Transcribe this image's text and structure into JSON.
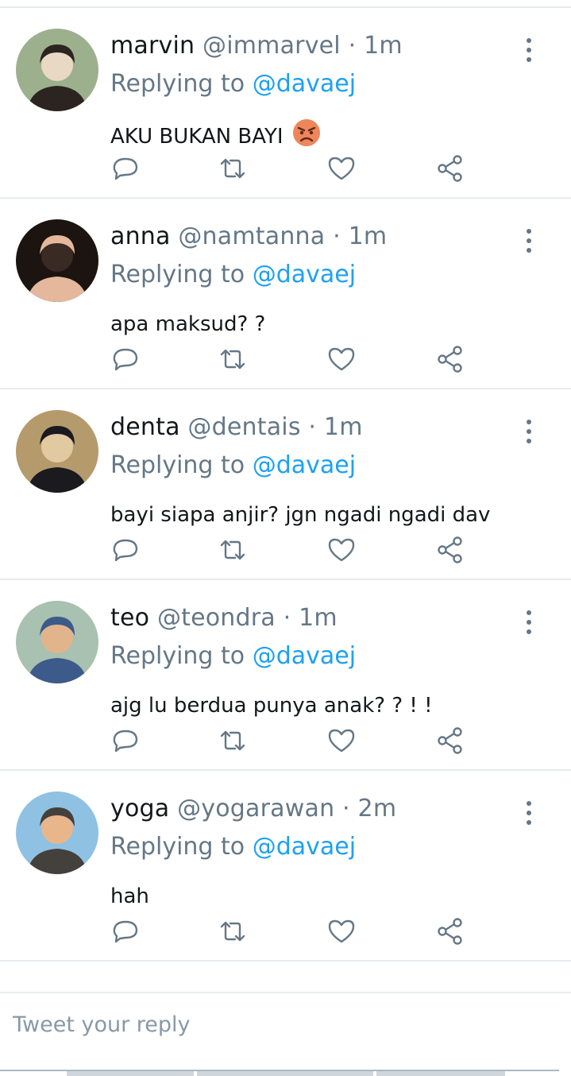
{
  "replies": [
    {
      "name": "marvin",
      "handle": "@immarvel",
      "separator": "·",
      "time": "1m",
      "replying_prefix": "Replying to",
      "replying_to": "@davaej",
      "text": "AKU BUKAN BAYI",
      "emoji": "angry-face",
      "avatar_colors": [
        "#9cb08d",
        "#2b2420",
        "#e9d9c4"
      ]
    },
    {
      "name": "anna",
      "handle": "@namtanna",
      "separator": "·",
      "time": "1m",
      "replying_prefix": "Replying to",
      "replying_to": "@davaej",
      "text": "apa maksud? ?",
      "avatar_colors": [
        "#1b1411",
        "#e5b79c",
        "#3a2a24"
      ]
    },
    {
      "name": "denta",
      "handle": "@dentais",
      "separator": "·",
      "time": "1m",
      "replying_prefix": "Replying to",
      "replying_to": "@davaej",
      "text": "bayi siapa anjir? jgn ngadi ngadi dav",
      "avatar_colors": [
        "#b59a6b",
        "#1a1a1f",
        "#e1c9a2"
      ]
    },
    {
      "name": "teo",
      "handle": "@teondra",
      "separator": "·",
      "time": "1m",
      "replying_prefix": "Replying to",
      "replying_to": "@davaej",
      "text": "ajg lu berdua punya anak? ? ! !",
      "avatar_colors": [
        "#a8c1b0",
        "#3c5a8a",
        "#e2b48c"
      ]
    },
    {
      "name": "yoga",
      "handle": "@yogarawan",
      "separator": "·",
      "time": "2m",
      "replying_prefix": "Replying to",
      "replying_to": "@davaej",
      "text": "hah",
      "avatar_colors": [
        "#8fc1e3",
        "#44403c",
        "#e9b58a"
      ]
    }
  ],
  "actions": {
    "reply_icon": "reply-icon",
    "retweet_icon": "retweet-icon",
    "like_icon": "heart-icon",
    "share_icon": "share-icon"
  },
  "compose": {
    "placeholder": "Tweet your reply"
  },
  "colors": {
    "text": "#14171a",
    "muted": "#657786",
    "accent": "#1da1f2",
    "divider": "#e6ecf0"
  }
}
